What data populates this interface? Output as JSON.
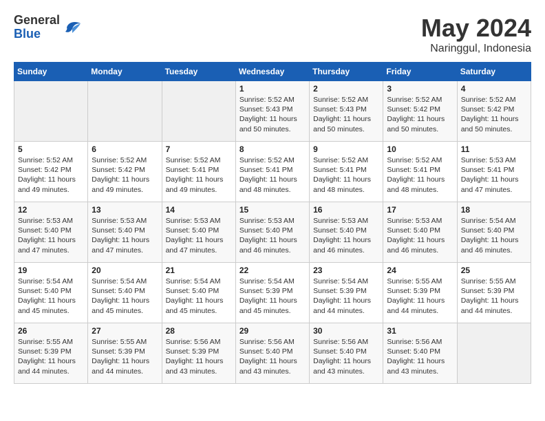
{
  "header": {
    "logo_general": "General",
    "logo_blue": "Blue",
    "title": "May 2024",
    "subtitle": "Naringgul, Indonesia"
  },
  "calendar": {
    "weekdays": [
      "Sunday",
      "Monday",
      "Tuesday",
      "Wednesday",
      "Thursday",
      "Friday",
      "Saturday"
    ],
    "weeks": [
      [
        {
          "day": "",
          "sunrise": "",
          "sunset": "",
          "daylight": ""
        },
        {
          "day": "",
          "sunrise": "",
          "sunset": "",
          "daylight": ""
        },
        {
          "day": "",
          "sunrise": "",
          "sunset": "",
          "daylight": ""
        },
        {
          "day": "1",
          "sunrise": "Sunrise: 5:52 AM",
          "sunset": "Sunset: 5:43 PM",
          "daylight": "Daylight: 11 hours and 50 minutes."
        },
        {
          "day": "2",
          "sunrise": "Sunrise: 5:52 AM",
          "sunset": "Sunset: 5:43 PM",
          "daylight": "Daylight: 11 hours and 50 minutes."
        },
        {
          "day": "3",
          "sunrise": "Sunrise: 5:52 AM",
          "sunset": "Sunset: 5:42 PM",
          "daylight": "Daylight: 11 hours and 50 minutes."
        },
        {
          "day": "4",
          "sunrise": "Sunrise: 5:52 AM",
          "sunset": "Sunset: 5:42 PM",
          "daylight": "Daylight: 11 hours and 50 minutes."
        }
      ],
      [
        {
          "day": "5",
          "sunrise": "Sunrise: 5:52 AM",
          "sunset": "Sunset: 5:42 PM",
          "daylight": "Daylight: 11 hours and 49 minutes."
        },
        {
          "day": "6",
          "sunrise": "Sunrise: 5:52 AM",
          "sunset": "Sunset: 5:42 PM",
          "daylight": "Daylight: 11 hours and 49 minutes."
        },
        {
          "day": "7",
          "sunrise": "Sunrise: 5:52 AM",
          "sunset": "Sunset: 5:41 PM",
          "daylight": "Daylight: 11 hours and 49 minutes."
        },
        {
          "day": "8",
          "sunrise": "Sunrise: 5:52 AM",
          "sunset": "Sunset: 5:41 PM",
          "daylight": "Daylight: 11 hours and 48 minutes."
        },
        {
          "day": "9",
          "sunrise": "Sunrise: 5:52 AM",
          "sunset": "Sunset: 5:41 PM",
          "daylight": "Daylight: 11 hours and 48 minutes."
        },
        {
          "day": "10",
          "sunrise": "Sunrise: 5:52 AM",
          "sunset": "Sunset: 5:41 PM",
          "daylight": "Daylight: 11 hours and 48 minutes."
        },
        {
          "day": "11",
          "sunrise": "Sunrise: 5:53 AM",
          "sunset": "Sunset: 5:41 PM",
          "daylight": "Daylight: 11 hours and 47 minutes."
        }
      ],
      [
        {
          "day": "12",
          "sunrise": "Sunrise: 5:53 AM",
          "sunset": "Sunset: 5:40 PM",
          "daylight": "Daylight: 11 hours and 47 minutes."
        },
        {
          "day": "13",
          "sunrise": "Sunrise: 5:53 AM",
          "sunset": "Sunset: 5:40 PM",
          "daylight": "Daylight: 11 hours and 47 minutes."
        },
        {
          "day": "14",
          "sunrise": "Sunrise: 5:53 AM",
          "sunset": "Sunset: 5:40 PM",
          "daylight": "Daylight: 11 hours and 47 minutes."
        },
        {
          "day": "15",
          "sunrise": "Sunrise: 5:53 AM",
          "sunset": "Sunset: 5:40 PM",
          "daylight": "Daylight: 11 hours and 46 minutes."
        },
        {
          "day": "16",
          "sunrise": "Sunrise: 5:53 AM",
          "sunset": "Sunset: 5:40 PM",
          "daylight": "Daylight: 11 hours and 46 minutes."
        },
        {
          "day": "17",
          "sunrise": "Sunrise: 5:53 AM",
          "sunset": "Sunset: 5:40 PM",
          "daylight": "Daylight: 11 hours and 46 minutes."
        },
        {
          "day": "18",
          "sunrise": "Sunrise: 5:54 AM",
          "sunset": "Sunset: 5:40 PM",
          "daylight": "Daylight: 11 hours and 46 minutes."
        }
      ],
      [
        {
          "day": "19",
          "sunrise": "Sunrise: 5:54 AM",
          "sunset": "Sunset: 5:40 PM",
          "daylight": "Daylight: 11 hours and 45 minutes."
        },
        {
          "day": "20",
          "sunrise": "Sunrise: 5:54 AM",
          "sunset": "Sunset: 5:40 PM",
          "daylight": "Daylight: 11 hours and 45 minutes."
        },
        {
          "day": "21",
          "sunrise": "Sunrise: 5:54 AM",
          "sunset": "Sunset: 5:40 PM",
          "daylight": "Daylight: 11 hours and 45 minutes."
        },
        {
          "day": "22",
          "sunrise": "Sunrise: 5:54 AM",
          "sunset": "Sunset: 5:39 PM",
          "daylight": "Daylight: 11 hours and 45 minutes."
        },
        {
          "day": "23",
          "sunrise": "Sunrise: 5:54 AM",
          "sunset": "Sunset: 5:39 PM",
          "daylight": "Daylight: 11 hours and 44 minutes."
        },
        {
          "day": "24",
          "sunrise": "Sunrise: 5:55 AM",
          "sunset": "Sunset: 5:39 PM",
          "daylight": "Daylight: 11 hours and 44 minutes."
        },
        {
          "day": "25",
          "sunrise": "Sunrise: 5:55 AM",
          "sunset": "Sunset: 5:39 PM",
          "daylight": "Daylight: 11 hours and 44 minutes."
        }
      ],
      [
        {
          "day": "26",
          "sunrise": "Sunrise: 5:55 AM",
          "sunset": "Sunset: 5:39 PM",
          "daylight": "Daylight: 11 hours and 44 minutes."
        },
        {
          "day": "27",
          "sunrise": "Sunrise: 5:55 AM",
          "sunset": "Sunset: 5:39 PM",
          "daylight": "Daylight: 11 hours and 44 minutes."
        },
        {
          "day": "28",
          "sunrise": "Sunrise: 5:56 AM",
          "sunset": "Sunset: 5:39 PM",
          "daylight": "Daylight: 11 hours and 43 minutes."
        },
        {
          "day": "29",
          "sunrise": "Sunrise: 5:56 AM",
          "sunset": "Sunset: 5:40 PM",
          "daylight": "Daylight: 11 hours and 43 minutes."
        },
        {
          "day": "30",
          "sunrise": "Sunrise: 5:56 AM",
          "sunset": "Sunset: 5:40 PM",
          "daylight": "Daylight: 11 hours and 43 minutes."
        },
        {
          "day": "31",
          "sunrise": "Sunrise: 5:56 AM",
          "sunset": "Sunset: 5:40 PM",
          "daylight": "Daylight: 11 hours and 43 minutes."
        },
        {
          "day": "",
          "sunrise": "",
          "sunset": "",
          "daylight": ""
        }
      ]
    ]
  }
}
